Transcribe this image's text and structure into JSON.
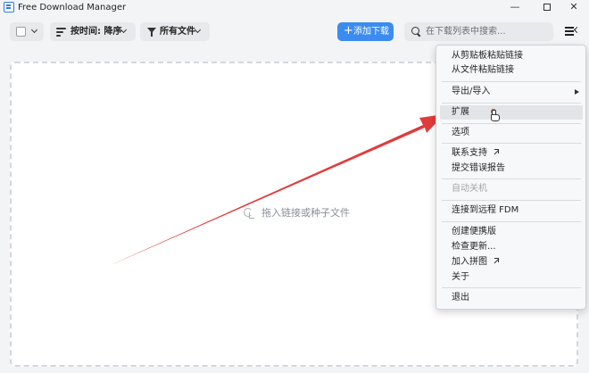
{
  "window": {
    "title": "Free Download Manager",
    "controls": {
      "minimize": "—",
      "maximize": "",
      "close": "✕"
    }
  },
  "toolbar": {
    "sort_label": "按时间: 降序",
    "filter_label": "所有文件",
    "add_button_label": "添加下载",
    "add_button_icon": "plus-icon",
    "search_placeholder": "在下载列表中搜索..."
  },
  "drop_area": {
    "hint": "拖入链接或种子文件"
  },
  "menu": {
    "items": [
      {
        "label": "从剪贴板粘贴链接"
      },
      {
        "label": "从文件粘贴链接"
      },
      {
        "label": "导出/导入",
        "has_submenu": true
      },
      {
        "label": "扩展",
        "highlighted": true
      },
      {
        "label": "选项"
      },
      {
        "label": "联系支持",
        "external": true
      },
      {
        "label": "提交错误报告"
      },
      {
        "label": "自动关机",
        "disabled": true
      },
      {
        "label": "连接到远程 FDM"
      },
      {
        "label": "创建便携版"
      },
      {
        "label": "检查更新..."
      },
      {
        "label": "加入拼图",
        "external": true
      },
      {
        "label": "关于"
      },
      {
        "label": "退出"
      }
    ]
  },
  "colors": {
    "accent": "#3c8cf0",
    "annotation": "#e03c3c",
    "background": "#f3f4f6"
  }
}
